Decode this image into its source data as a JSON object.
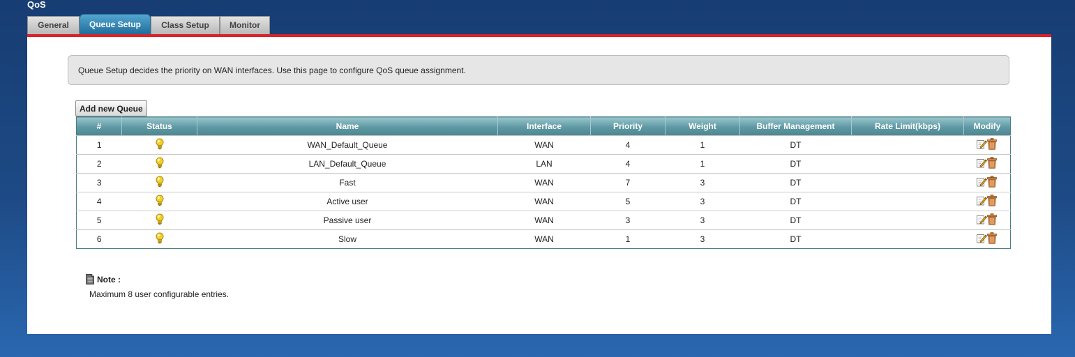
{
  "page": {
    "title": "QoS"
  },
  "tabs": [
    {
      "label": "General",
      "active": false
    },
    {
      "label": "Queue Setup",
      "active": true
    },
    {
      "label": "Class Setup",
      "active": false
    },
    {
      "label": "Monitor",
      "active": false
    }
  ],
  "info": {
    "text": "Queue Setup decides the priority on WAN interfaces. Use this page to configure QoS queue assignment."
  },
  "toolbar": {
    "add_label": "Add new Queue"
  },
  "table": {
    "columns": [
      "#",
      "Status",
      "Name",
      "Interface",
      "Priority",
      "Weight",
      "Buffer Management",
      "Rate Limit(kbps)",
      "Modify"
    ],
    "rows": [
      {
        "num": "1",
        "status": "bulb-icon",
        "name": "WAN_Default_Queue",
        "interface": "WAN",
        "priority": "4",
        "weight": "1",
        "buffer": "DT",
        "rate": ""
      },
      {
        "num": "2",
        "status": "bulb-icon",
        "name": "LAN_Default_Queue",
        "interface": "LAN",
        "priority": "4",
        "weight": "1",
        "buffer": "DT",
        "rate": ""
      },
      {
        "num": "3",
        "status": "bulb-icon",
        "name": "Fast",
        "interface": "WAN",
        "priority": "7",
        "weight": "3",
        "buffer": "DT",
        "rate": ""
      },
      {
        "num": "4",
        "status": "bulb-icon",
        "name": "Active user",
        "interface": "WAN",
        "priority": "5",
        "weight": "3",
        "buffer": "DT",
        "rate": ""
      },
      {
        "num": "5",
        "status": "bulb-icon",
        "name": "Passive user",
        "interface": "WAN",
        "priority": "3",
        "weight": "3",
        "buffer": "DT",
        "rate": ""
      },
      {
        "num": "6",
        "status": "bulb-icon",
        "name": "Slow",
        "interface": "WAN",
        "priority": "1",
        "weight": "3",
        "buffer": "DT",
        "rate": ""
      }
    ]
  },
  "note": {
    "title": "Note :",
    "text": "Maximum 8 user configurable entries."
  },
  "colors": {
    "accent_red": "#d8232a",
    "header_teal": "#5e98a2",
    "tab_active": "#1f6d9c",
    "bulb_yellow": "#f4d22a"
  }
}
